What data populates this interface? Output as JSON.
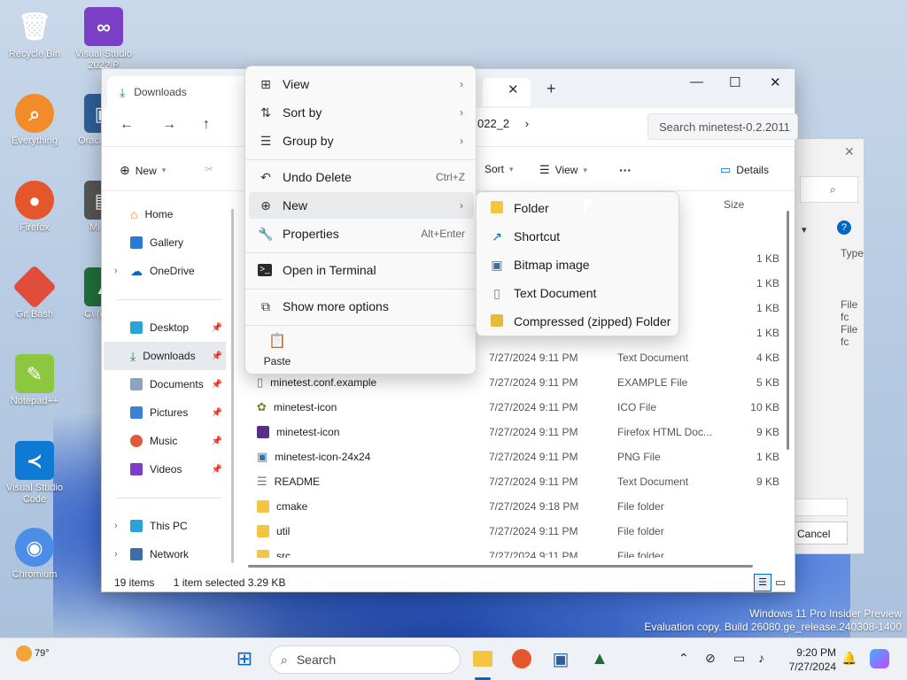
{
  "desktop": {
    "icons": [
      "Recycle Bin",
      "Visual Studio 2022 P",
      "Everything",
      "Oracle Virtu",
      "Firefox",
      "Mi Insi",
      "Git Bash",
      "C\\ (cmak",
      "Notepad++",
      "Visual Studio Code",
      "Chromium"
    ],
    "badge": "PRE"
  },
  "explorer": {
    "tab_title": "Downloads",
    "breadcrumb": "022_2",
    "search_placeholder": "Search minetest-0.2.2011",
    "toolbar": {
      "new": "New",
      "sort": "Sort",
      "view": "View",
      "more": "···",
      "details": "Details"
    },
    "sidebar": {
      "home": "Home",
      "gallery": "Gallery",
      "onedrive": "OneDrive",
      "desktop": "Desktop",
      "downloads": "Downloads",
      "documents": "Documents",
      "pictures": "Pictures",
      "music": "Music",
      "videos": "Videos",
      "thispc": "This PC",
      "network": "Network"
    },
    "columns": {
      "size": "Size"
    },
    "rows": [
      {
        "name": "",
        "date": "",
        "type": "Sour...",
        "size": "1 KB"
      },
      {
        "name": "",
        "date": "",
        "type": "urce ...",
        "size": "1 KB"
      },
      {
        "name": "",
        "date": "",
        "type": "le",
        "size": "1 KB"
      },
      {
        "name": "",
        "date": "",
        "type": "",
        "size": "1 KB"
      },
      {
        "name": "",
        "date": "7/27/2024 9:11 PM",
        "type": "Text Document",
        "size": "4 KB"
      },
      {
        "name": "minetest.conf.example",
        "date": "7/27/2024 9:11 PM",
        "type": "EXAMPLE File",
        "size": "5 KB"
      },
      {
        "name": "minetest-icon",
        "date": "7/27/2024 9:11 PM",
        "type": "ICO File",
        "size": "10 KB"
      },
      {
        "name": "minetest-icon",
        "date": "7/27/2024 9:11 PM",
        "type": "Firefox HTML Doc...",
        "size": "9 KB"
      },
      {
        "name": "minetest-icon-24x24",
        "date": "7/27/2024 9:11 PM",
        "type": "PNG File",
        "size": "1 KB"
      },
      {
        "name": "README",
        "date": "7/27/2024 9:11 PM",
        "type": "Text Document",
        "size": "9 KB"
      },
      {
        "name": "cmake",
        "date": "7/27/2024 9:18 PM",
        "type": "File folder",
        "size": ""
      },
      {
        "name": "util",
        "date": "7/27/2024 9:11 PM",
        "type": "File folder",
        "size": ""
      },
      {
        "name": "src",
        "date": "7/27/2024 9:11 PM",
        "type": "File folder",
        "size": ""
      }
    ],
    "status": {
      "items": "19 items",
      "selected": "1 item selected  3.29 KB"
    }
  },
  "context_menu": {
    "view": "View",
    "sort_by": "Sort by",
    "group_by": "Group by",
    "undo_delete": "Undo Delete",
    "undo_shortcut": "Ctrl+Z",
    "new": "New",
    "properties": "Properties",
    "properties_shortcut": "Alt+Enter",
    "open_terminal": "Open in Terminal",
    "show_more": "Show more options",
    "paste": "Paste"
  },
  "submenu_new": {
    "folder": "Folder",
    "shortcut": "Shortcut",
    "bitmap": "Bitmap image",
    "text": "Text Document",
    "zip": "Compressed (zipped) Folder"
  },
  "background_dialog": {
    "type_label": "Type",
    "row1": "File fc",
    "row2": "File fc",
    "cancel": "Cancel"
  },
  "watermark": {
    "line1": "Windows 11 Pro Insider Preview",
    "line2": "Evaluation copy. Build 26080.ge_release.240308-1400"
  },
  "taskbar": {
    "weather_temp": "79°",
    "search": "Search",
    "time": "9:20 PM",
    "date": "7/27/2024"
  },
  "colors": {
    "accent": "#0067c0",
    "folder": "#f4c542",
    "hover": "#e9eaec"
  }
}
